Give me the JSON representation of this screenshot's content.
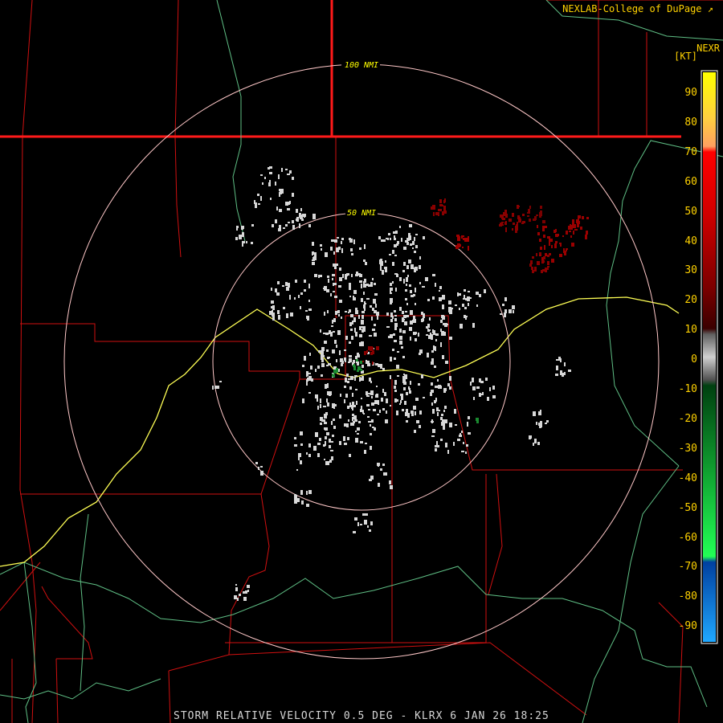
{
  "header": {
    "credit": "NEXLAB-College of DuPage",
    "product_code": "NEXR",
    "unit": "[KT]"
  },
  "footer": {
    "caption": "STORM RELATIVE VELOCITY 0.5 DEG - KLRX 6 JAN 26 18:25"
  },
  "range_rings": {
    "inner_label": "50 NMI",
    "outer_label": "100 NMI"
  },
  "legend": {
    "ticks": [
      "90",
      "80",
      "70",
      "60",
      "50",
      "40",
      "30",
      "20",
      "10",
      "0",
      "-10",
      "-20",
      "-30",
      "-40",
      "-50",
      "-60",
      "-70",
      "-80",
      "-90"
    ],
    "colors": {
      "approaching_strong": "#ffff00",
      "approaching_weak": "#ff0000",
      "zero": "#aaaaaa",
      "receding_weak": "#00cc33",
      "receding_strong": "#1aa3ff"
    }
  },
  "map_colors": {
    "background": "#000000",
    "county_lines": "#dd1111",
    "state_lines": "#ff1111",
    "highways": "#ffff55",
    "rivers": "#66cc88",
    "range_rings": "#ffc8c8",
    "ring_labels": "#ffff00"
  }
}
